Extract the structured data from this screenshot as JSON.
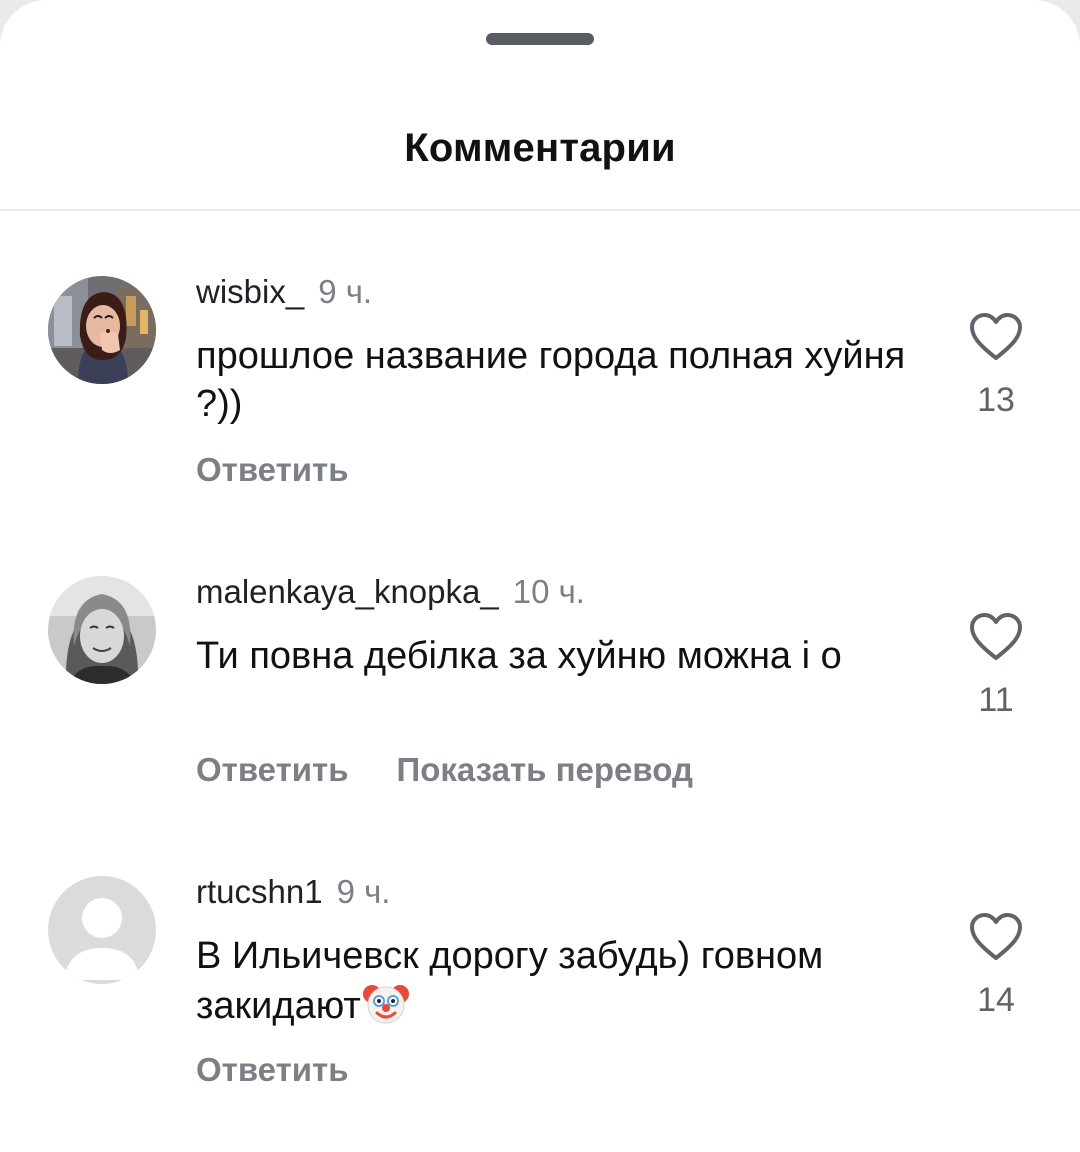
{
  "sheet": {
    "title": "Комментарии"
  },
  "comments": [
    {
      "username": "wisbix_",
      "time": "9 ч.",
      "text": "прошлое название города полная хуйня ?))",
      "likes": "13",
      "actions": [
        "Ответить"
      ],
      "avatar": "photo-woman-covering-face-icon"
    },
    {
      "username": "malenkaya_knopka_",
      "time": "10 ч.",
      "text": "Ти повна дебілка за хуйню можна і о",
      "likes": "11",
      "actions": [
        "Ответить",
        "Показать перевод"
      ],
      "avatar": "photo-woman-smiling-bw-icon"
    },
    {
      "username": "rtucshn1",
      "time": "9 ч.",
      "text": "В Ильичевск дорогу забудь) говном закидают",
      "emoji": "🤡",
      "likes": "14",
      "actions": [
        "Ответить"
      ],
      "avatar": "default-user-icon"
    }
  ],
  "colors": {
    "background": "#ffffff",
    "text": "#111111",
    "muted": "#7c7f86",
    "handle": "#595c63"
  }
}
